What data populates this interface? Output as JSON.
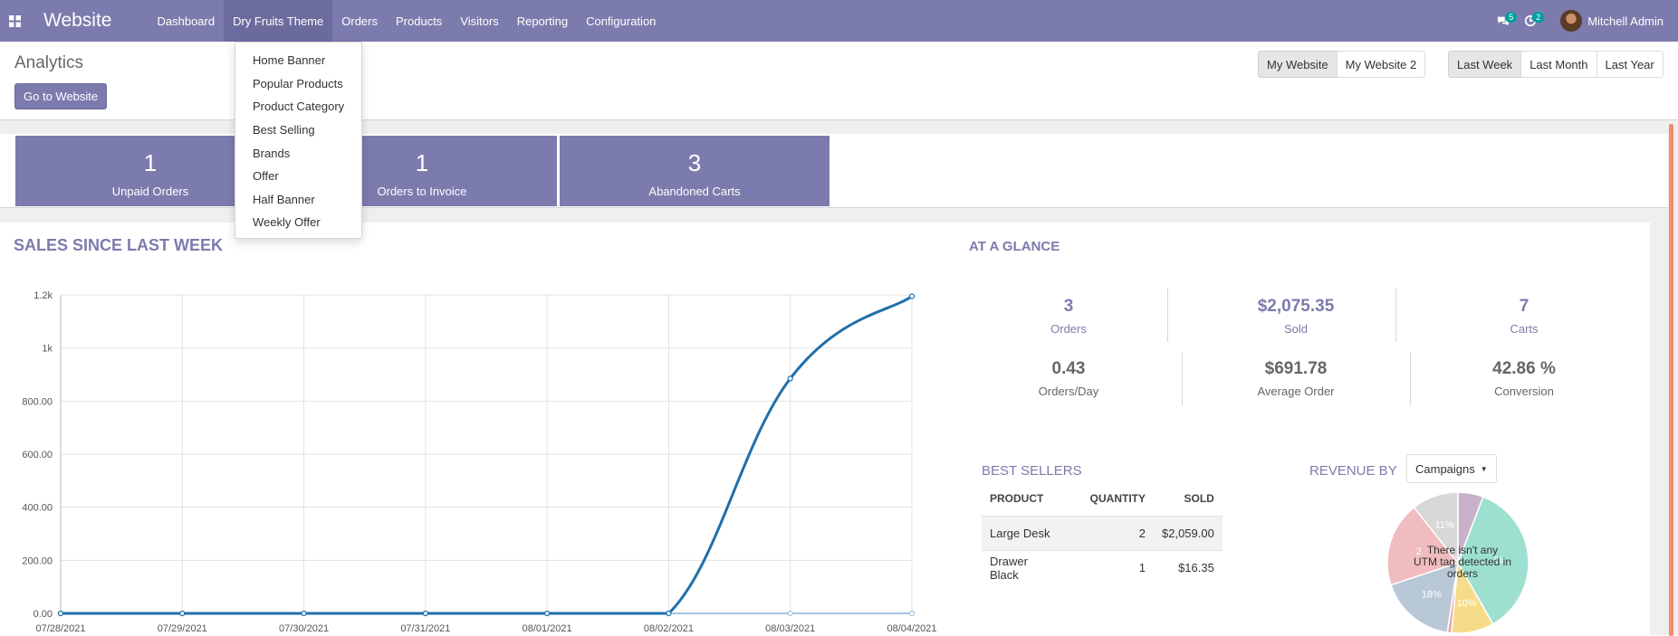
{
  "navbar": {
    "brand": "Website",
    "menu": [
      {
        "label": "Dashboard"
      },
      {
        "label": "Dry Fruits Theme"
      },
      {
        "label": "Orders"
      },
      {
        "label": "Products"
      },
      {
        "label": "Visitors"
      },
      {
        "label": "Reporting"
      },
      {
        "label": "Configuration"
      }
    ],
    "messages_count": "5",
    "activities_count": "2",
    "user_name": "Mitchell Admin"
  },
  "theme_menu": {
    "items": [
      {
        "label": "Home Banner"
      },
      {
        "label": "Popular Products"
      },
      {
        "label": "Product Category"
      },
      {
        "label": "Best Selling"
      },
      {
        "label": "Brands"
      },
      {
        "label": "Offer"
      },
      {
        "label": "Half Banner"
      },
      {
        "label": "Weekly Offer"
      }
    ]
  },
  "control": {
    "title": "Analytics",
    "go_to_website": "Go to Website",
    "websites": [
      "My Website",
      "My Website 2"
    ],
    "periods": [
      "Last Week",
      "Last Month",
      "Last Year"
    ]
  },
  "kpis": [
    {
      "value": "1",
      "label": "Unpaid Orders"
    },
    {
      "value": "1",
      "label": "Orders to Invoice"
    },
    {
      "value": "3",
      "label": "Abandoned Carts"
    }
  ],
  "sales": {
    "title": "SALES SINCE LAST WEEK"
  },
  "chart_data": {
    "type": "line",
    "x": [
      "07/28/2021",
      "07/29/2021",
      "07/30/2021",
      "07/31/2021",
      "08/01/2021",
      "08/02/2021",
      "08/03/2021",
      "08/04/2021"
    ],
    "series": [
      {
        "values": [
          0,
          0,
          0,
          0,
          0,
          0,
          885,
          1195
        ],
        "color": "#1f6faa"
      },
      {
        "values": [
          0,
          0,
          0,
          0,
          0,
          0,
          0,
          0
        ],
        "color": "#a9c4dc"
      }
    ],
    "yticks": [
      "0.00",
      "200.00",
      "400.00",
      "600.00",
      "800.00",
      "1k",
      "1.2k"
    ],
    "ylim": [
      0,
      1200
    ],
    "grid": true
  },
  "glance": {
    "title": "AT A GLANCE",
    "stats": [
      {
        "value": "3",
        "caption": "Orders"
      },
      {
        "value": "$2,075.35",
        "caption": "Sold"
      },
      {
        "value": "7",
        "caption": "Carts"
      },
      {
        "value": "0.43",
        "caption": "Orders/Day"
      },
      {
        "value": "$691.78",
        "caption": "Average Order"
      },
      {
        "value": "42.86 %",
        "caption": "Conversion"
      }
    ]
  },
  "best_sellers": {
    "title": "BEST SELLERS",
    "columns": [
      "PRODUCT",
      "QUANTITY",
      "SOLD"
    ],
    "rows": [
      [
        "Large Desk",
        "2",
        "$2,059.00"
      ],
      [
        "Drawer Black",
        "1",
        "$16.35"
      ]
    ]
  },
  "revenue": {
    "title": "REVENUE BY",
    "dropdown": "Campaigns",
    "note_line1": "There isn't any",
    "note_line2": "UTM tag detected in orders",
    "pie": [
      {
        "label": "",
        "value": 6,
        "color": "#c9b1c9"
      },
      {
        "label": "%",
        "value": 37,
        "color": "#9ee0cf"
      },
      {
        "label": "10%",
        "value": 10,
        "color": "#f6dc8a"
      },
      {
        "label": "",
        "value": 1,
        "color": "#e8a8a8"
      },
      {
        "label": "18%",
        "value": 18,
        "color": "#b8c8d6"
      },
      {
        "label": "2",
        "value": 20,
        "color": "#f1bcbf"
      },
      {
        "label": "11%",
        "value": 11,
        "color": "#d8d8d8"
      }
    ]
  },
  "colors": {
    "brand": "#7c7bad",
    "line": "#1f6faa",
    "accent": "#00a09d"
  }
}
